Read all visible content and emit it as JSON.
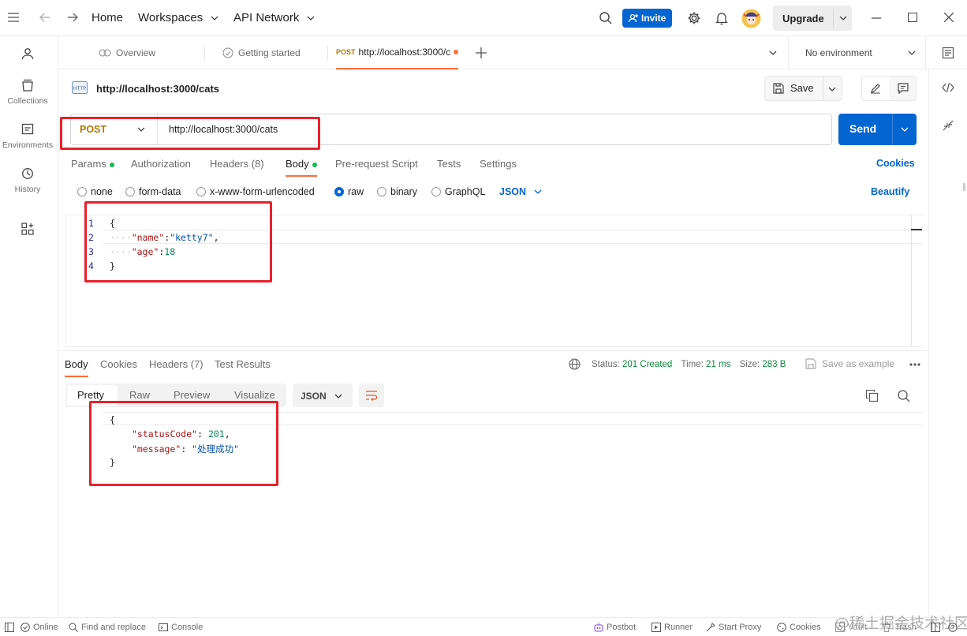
{
  "titlebar": {
    "home": "Home",
    "workspaces": "Workspaces",
    "api_network": "API Network",
    "invite": "Invite",
    "upgrade": "Upgrade"
  },
  "sidebar": {
    "items": [
      {
        "label": ""
      },
      {
        "label": "Collections"
      },
      {
        "label": "Environments"
      },
      {
        "label": "History"
      },
      {
        "label": ""
      }
    ]
  },
  "tabs": {
    "overview": "Overview",
    "getting_started": "Getting started",
    "active_method": "POST",
    "active_url": "http://localhost:3000/c",
    "environment": "No environment"
  },
  "request": {
    "title": "http://localhost:3000/cats",
    "save": "Save",
    "method": "POST",
    "url": "http://localhost:3000/cats",
    "send": "Send",
    "subtabs": {
      "params": "Params",
      "authorization": "Authorization",
      "headers": "Headers (8)",
      "body": "Body",
      "prerequest": "Pre-request Script",
      "tests": "Tests",
      "settings": "Settings",
      "cookies": "Cookies"
    },
    "body_types": {
      "none": "none",
      "form_data": "form-data",
      "urlencoded": "x-www-form-urlencoded",
      "raw": "raw",
      "binary": "binary",
      "graphql": "GraphQL",
      "format": "JSON",
      "beautify": "Beautify"
    },
    "lines": [
      {
        "n": "1",
        "open": "{"
      },
      {
        "n": "2",
        "dots": "····",
        "key": "\"name\"",
        "colon": ":",
        "value": "\"ketty7\"",
        "trail": ","
      },
      {
        "n": "3",
        "dots": "····",
        "key": "\"age\"",
        "colon": ":",
        "value": "18"
      },
      {
        "n": "4",
        "close": "}"
      }
    ]
  },
  "response": {
    "tabs": {
      "body": "Body",
      "cookies": "Cookies",
      "headers": "Headers (7)",
      "tests": "Test Results"
    },
    "status_label": "Status:",
    "status": "201 Created",
    "time_label": "Time:",
    "time": "21 ms",
    "size_label": "Size:",
    "size": "283 B",
    "save_example": "Save as example",
    "views": {
      "pretty": "Pretty",
      "raw": "Raw",
      "preview": "Preview",
      "visualize": "Visualize"
    },
    "format": "JSON",
    "lines": [
      {
        "open": "{"
      },
      {
        "key": "\"statusCode\"",
        "colon": ": ",
        "value": "201",
        "trail": ","
      },
      {
        "key": "\"message\"",
        "colon": ": ",
        "value": "\"处理成功\""
      },
      {
        "close": "}"
      }
    ]
  },
  "statusbar": {
    "online": "Online",
    "find": "Find and replace",
    "console": "Console",
    "postbot": "Postbot",
    "runner": "Runner",
    "proxy": "Start Proxy",
    "cookies": "Cookies",
    "vault": "Vault",
    "trash": "Trash",
    "watermark": "@稀土掘金技术社区"
  },
  "colors": {
    "accent": "#0265d2",
    "status_ok": "#0cbb52",
    "annotation": "#e8212b",
    "post": "#ad7a03"
  }
}
